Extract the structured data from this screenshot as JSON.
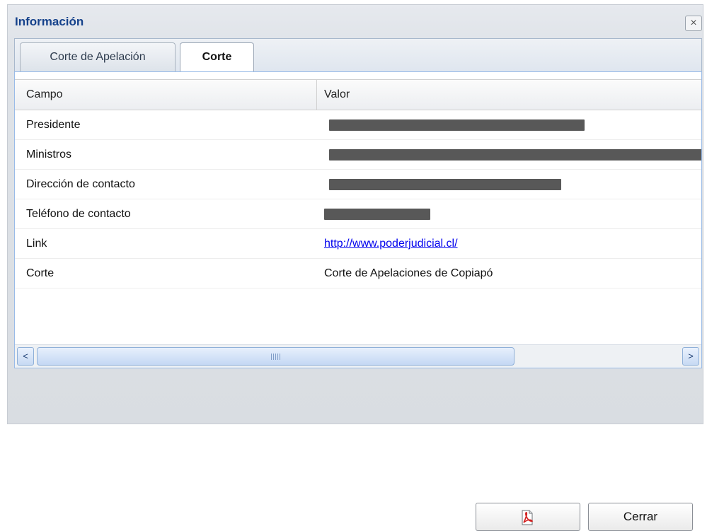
{
  "window": {
    "title": "Información",
    "close_symbol": "×"
  },
  "tabs": [
    {
      "label": "Corte de Apelación",
      "active": false
    },
    {
      "label": "Corte",
      "active": true
    }
  ],
  "grid": {
    "columns": [
      "Campo",
      "Valor"
    ],
    "rows": [
      {
        "campo": "Presidente",
        "valor": "",
        "redacted": true
      },
      {
        "campo": "Ministros",
        "valor": "",
        "redacted": true
      },
      {
        "campo": "Dirección de contacto",
        "valor": "",
        "redacted": true
      },
      {
        "campo": "Teléfono de contacto",
        "valor": "",
        "redacted": true
      },
      {
        "campo": "Link",
        "valor": "http://www.poderjudicial.cl/",
        "link": true
      },
      {
        "campo": "Corte",
        "valor": "Corte de Apelaciones de Copiapó"
      }
    ]
  },
  "scrollbar": {
    "left_arrow": "<",
    "right_arrow": ">"
  },
  "footer": {
    "pdf_icon": "pdf-icon",
    "close_label": "Cerrar"
  },
  "colors": {
    "title": "#15428b",
    "link": "#0000ee",
    "grid_border": "#99bbe8"
  }
}
